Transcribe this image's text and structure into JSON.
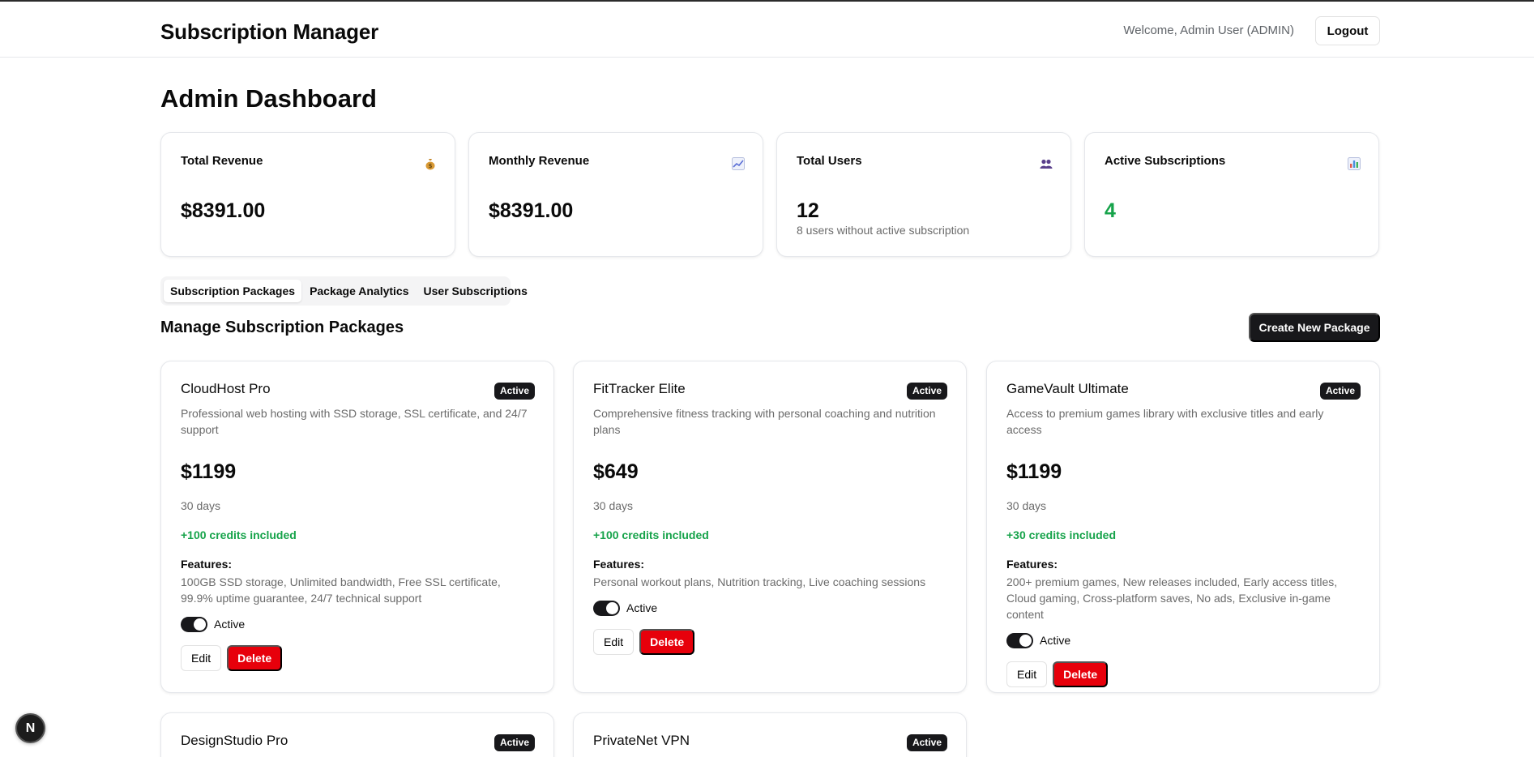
{
  "header": {
    "app_title": "Subscription Manager",
    "welcome_text": "Welcome, Admin User (ADMIN)",
    "logout_label": "Logout"
  },
  "page_title": "Admin Dashboard",
  "stats": [
    {
      "label": "Total Revenue",
      "value": "$8391.00",
      "sub": "",
      "icon": "money-bag-icon"
    },
    {
      "label": "Monthly Revenue",
      "value": "$8391.00",
      "sub": "",
      "icon": "chart-increasing-icon"
    },
    {
      "label": "Total Users",
      "value": "12",
      "sub": "8 users without active subscription",
      "icon": "users-icon"
    },
    {
      "label": "Active Subscriptions",
      "value": "4",
      "sub": "",
      "icon": "bar-chart-icon",
      "value_color": "#16a34a"
    }
  ],
  "tabs": [
    {
      "label": "Subscription Packages",
      "active": true
    },
    {
      "label": "Package Analytics",
      "active": false
    },
    {
      "label": "User Subscriptions",
      "active": false
    }
  ],
  "section": {
    "title": "Manage Subscription Packages",
    "create_label": "Create New Package"
  },
  "packages": [
    {
      "name": "CloudHost Pro",
      "badge": "Active",
      "description": "Professional web hosting with SSD storage, SSL certificate, and 24/7 support",
      "price": "$1199",
      "duration": "30 days",
      "credits": "+100 credits included",
      "features_label": "Features:",
      "features": "100GB SSD storage, Unlimited bandwidth, Free SSL certificate, 99.9% uptime guarantee, 24/7 technical support",
      "toggle_label": "Active",
      "edit_label": "Edit",
      "delete_label": "Delete"
    },
    {
      "name": "FitTracker Elite",
      "badge": "Active",
      "description": "Comprehensive fitness tracking with personal coaching and nutrition plans",
      "price": "$649",
      "duration": "30 days",
      "credits": "+100 credits included",
      "features_label": "Features:",
      "features": "Personal workout plans, Nutrition tracking, Live coaching sessions",
      "toggle_label": "Active",
      "edit_label": "Edit",
      "delete_label": "Delete"
    },
    {
      "name": "GameVault Ultimate",
      "badge": "Active",
      "description": "Access to premium games library with exclusive titles and early access",
      "price": "$1199",
      "duration": "30 days",
      "credits": "+30 credits included",
      "features_label": "Features:",
      "features": "200+ premium games, New releases included, Early access titles, Cloud gaming, Cross-platform saves, No ads, Exclusive in-game content",
      "toggle_label": "Active",
      "edit_label": "Edit",
      "delete_label": "Delete"
    },
    {
      "name": "DesignStudio Pro",
      "badge": "Active"
    },
    {
      "name": "PrivateNet VPN",
      "badge": "Active"
    }
  ],
  "fab_label": "N",
  "colors": {
    "accent": "#18181b",
    "success": "#16a34a",
    "danger": "#e7000b"
  }
}
